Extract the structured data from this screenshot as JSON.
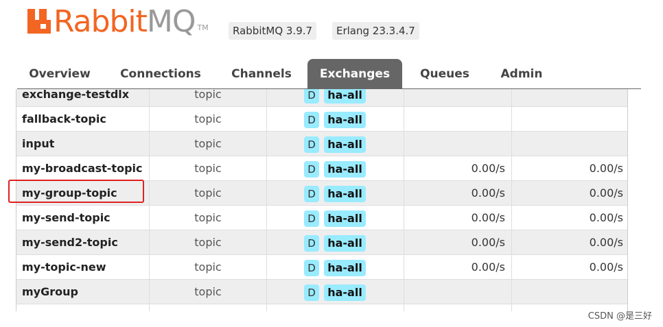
{
  "header": {
    "logo_text": "Rabbit",
    "logo_text_mq": "MQ",
    "logo_tm": "TM",
    "version_badge": "RabbitMQ 3.9.7",
    "erlang_badge": "Erlang 23.3.4.7"
  },
  "tabs": [
    {
      "label": "Overview",
      "active": false
    },
    {
      "label": "Connections",
      "active": false
    },
    {
      "label": "Channels",
      "active": false
    },
    {
      "label": "Exchanges",
      "active": true
    },
    {
      "label": "Queues",
      "active": false
    },
    {
      "label": "Admin",
      "active": false
    }
  ],
  "exchanges": [
    {
      "name": "exchange-testdlx",
      "type": "topic",
      "durable": "D",
      "policy": "ha-all",
      "rate_in": "",
      "rate_out": ""
    },
    {
      "name": "fallback-topic",
      "type": "topic",
      "durable": "D",
      "policy": "ha-all",
      "rate_in": "",
      "rate_out": ""
    },
    {
      "name": "input",
      "type": "topic",
      "durable": "D",
      "policy": "ha-all",
      "rate_in": "",
      "rate_out": ""
    },
    {
      "name": "my-broadcast-topic",
      "type": "topic",
      "durable": "D",
      "policy": "ha-all",
      "rate_in": "0.00/s",
      "rate_out": "0.00/s"
    },
    {
      "name": "my-group-topic",
      "type": "topic",
      "durable": "D",
      "policy": "ha-all",
      "rate_in": "0.00/s",
      "rate_out": "0.00/s"
    },
    {
      "name": "my-send-topic",
      "type": "topic",
      "durable": "D",
      "policy": "ha-all",
      "rate_in": "0.00/s",
      "rate_out": "0.00/s"
    },
    {
      "name": "my-send2-topic",
      "type": "topic",
      "durable": "D",
      "policy": "ha-all",
      "rate_in": "0.00/s",
      "rate_out": "0.00/s"
    },
    {
      "name": "my-topic-new",
      "type": "topic",
      "durable": "D",
      "policy": "ha-all",
      "rate_in": "0.00/s",
      "rate_out": "0.00/s"
    },
    {
      "name": "myGroup",
      "type": "topic",
      "durable": "D",
      "policy": "ha-all",
      "rate_in": "",
      "rate_out": ""
    },
    {
      "name": "",
      "type": "",
      "durable": "",
      "policy": "",
      "rate_in": "",
      "rate_out": ""
    }
  ],
  "watermark": "CSDN @是三好",
  "colors": {
    "brand": "#f26522",
    "active_tab": "#666666",
    "badge": "#99ebff",
    "highlight": "#e02020"
  }
}
